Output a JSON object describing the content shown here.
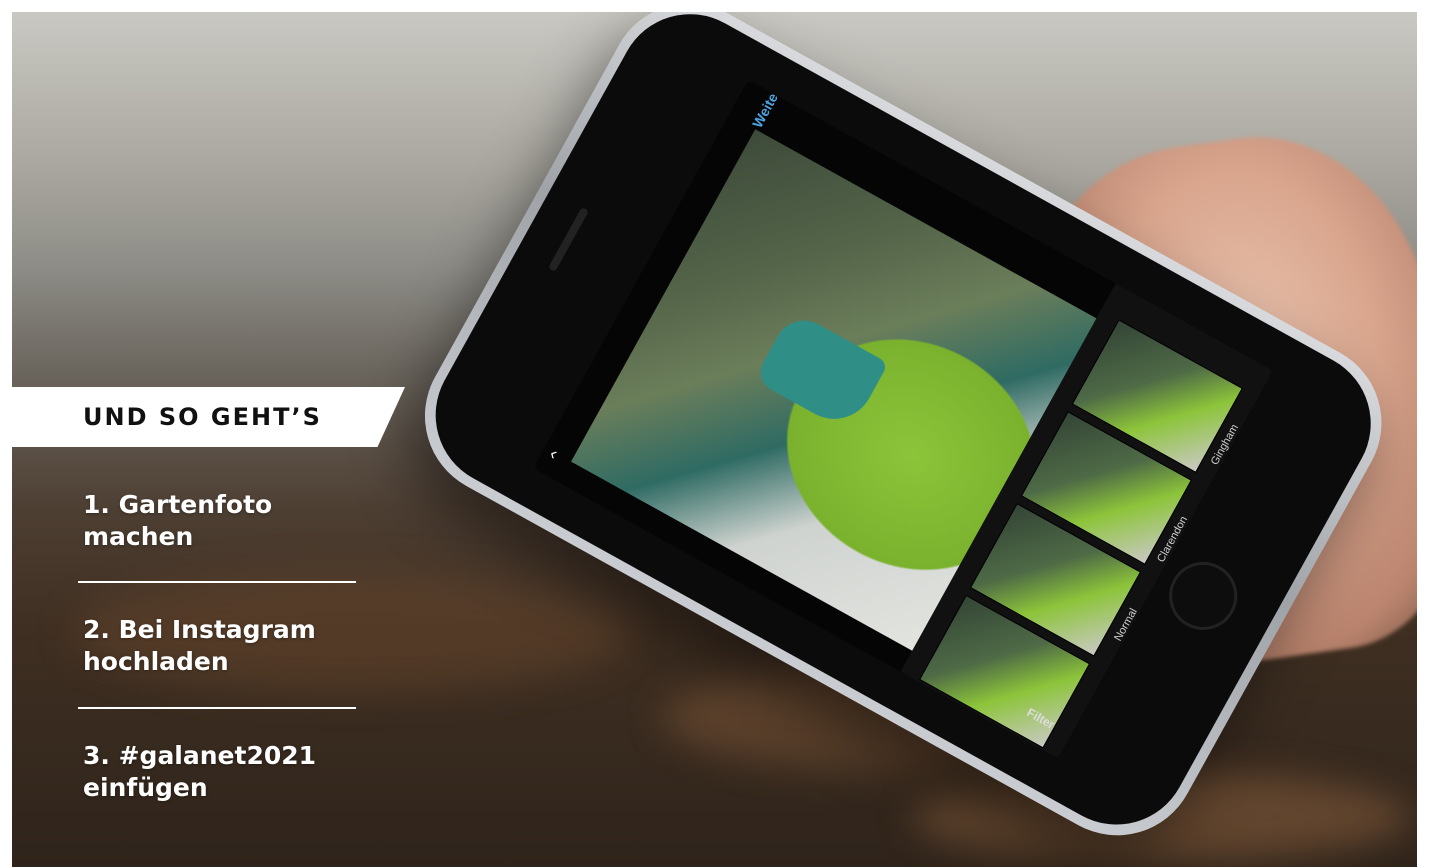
{
  "banner": {
    "title": "UND SO GEHT’S"
  },
  "steps": [
    {
      "line1": "1. Gartenfoto",
      "line2": "machen"
    },
    {
      "line1": "2. Bei Instagram",
      "line2": "hochladen"
    },
    {
      "line1": "3. #galanet2021",
      "line2": "einfügen"
    }
  ],
  "phone_screen": {
    "next_label": "Weiter",
    "filter_names": [
      "Normal",
      "Clarendon",
      "Gingham"
    ],
    "tab_label": "Filter",
    "icons": [
      "back-chevron-icon",
      "magic-wand-icon"
    ]
  },
  "colors": {
    "banner_bg": "#ffffff",
    "banner_text": "#111111",
    "step_text": "#ffffff",
    "accent_blue": "#4aa3e0"
  }
}
